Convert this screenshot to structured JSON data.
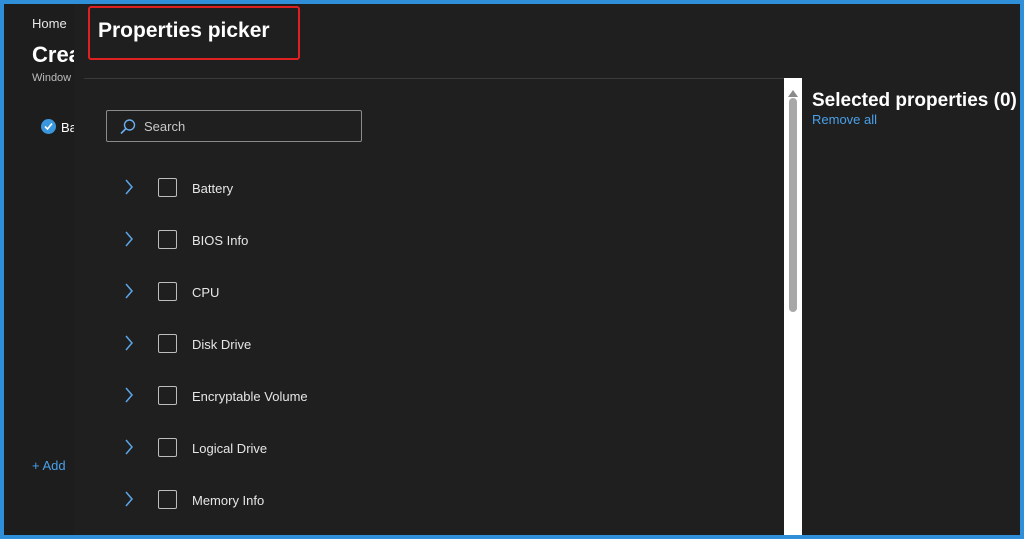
{
  "background_page": {
    "breadcrumb": "Home",
    "title": "Crea",
    "subtitle": "Window",
    "checkbox_label": "Ba",
    "add_link": "+ Add"
  },
  "blade": {
    "title": "Properties picker",
    "search": {
      "placeholder": "Search",
      "value": ""
    },
    "properties": [
      {
        "label": "Battery",
        "checked": false
      },
      {
        "label": "BIOS Info",
        "checked": false
      },
      {
        "label": "CPU",
        "checked": false
      },
      {
        "label": "Disk Drive",
        "checked": false
      },
      {
        "label": "Encryptable Volume",
        "checked": false
      },
      {
        "label": "Logical Drive",
        "checked": false
      },
      {
        "label": "Memory Info",
        "checked": false
      }
    ],
    "selected": {
      "title": "Selected properties (0)",
      "remove_all": "Remove all"
    }
  },
  "icons": {
    "search": "search-icon",
    "expand": "chevron-right-icon",
    "checkmark": "checkmark-icon",
    "scroll_up": "triangle-up-icon",
    "scroll_down": "triangle-down-icon"
  },
  "colors": {
    "accent": "#4aa0ea",
    "highlight_box": "#e02020",
    "frame_border": "#2f8fd8",
    "background": "#1f1f1f"
  }
}
